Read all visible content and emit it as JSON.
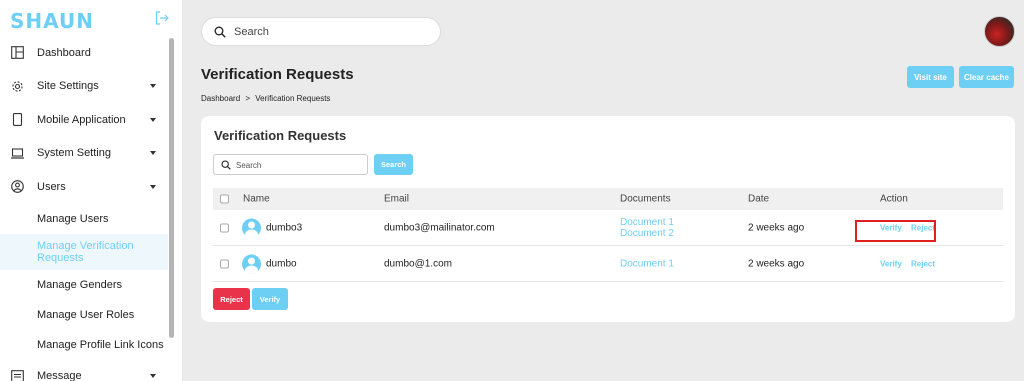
{
  "sidebar": {
    "logo": "SHAUN",
    "items": [
      {
        "label": "Dashboard",
        "icon": "layout-icon"
      },
      {
        "label": "Site Settings",
        "icon": "gear-icon"
      },
      {
        "label": "Mobile Application",
        "icon": "phone-icon"
      },
      {
        "label": "System Setting",
        "icon": "laptop-icon"
      },
      {
        "label": "Users",
        "icon": "user-circle-icon"
      }
    ],
    "sub_items": [
      "Manage Users",
      "Manage Verification Requests",
      "Manage Genders",
      "Manage User Roles",
      "Manage Profile Link Icons"
    ],
    "last_item": {
      "label": "Message",
      "icon": "message-icon"
    }
  },
  "topbar": {
    "search_placeholder": "Search"
  },
  "header": {
    "title": "Verification Requests",
    "breadcrumb_home": "Dashboard",
    "breadcrumb_sep": ">",
    "breadcrumb_current": "Verification Requests",
    "visit_site": "Visit site",
    "clear_cache": "Clear cache"
  },
  "card": {
    "title": "Verification Requests",
    "search_placeholder": "Search",
    "search_button": "Search",
    "columns": [
      "Name",
      "Email",
      "Documents",
      "Date",
      "Action"
    ],
    "rows": [
      {
        "name": "dumbo3",
        "email": "dumbo3@mailinator.com",
        "doc1": "Document 1",
        "doc2": "Document 2",
        "date": "2 weeks ago",
        "verify": "Verify",
        "reject": "Reject"
      },
      {
        "name": "dumbo",
        "email": "dumbo@1.com",
        "doc1": "Document 1",
        "date": "2 weeks ago",
        "verify": "Verify",
        "reject": "Reject"
      }
    ],
    "bulk_reject": "Reject",
    "bulk_verify": "Verify"
  },
  "colors": {
    "accent": "#6ecff5",
    "danger": "#e8334a",
    "highlight": "#e02020"
  }
}
